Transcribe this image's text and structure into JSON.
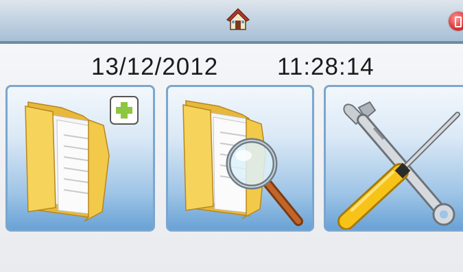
{
  "header": {
    "home_icon": "home-icon",
    "close_icon": "power-icon"
  },
  "status": {
    "date": "13/12/2012",
    "time": "11:28:14"
  },
  "tiles": [
    {
      "icon": "new-folder-icon"
    },
    {
      "icon": "search-folder-icon"
    },
    {
      "icon": "tools-icon"
    }
  ],
  "colors": {
    "topbar": "#bfd0e0",
    "tile_border": "#7aa6cf",
    "tile_gradient_bottom": "#6aa2d6",
    "folder_yellow": "#f3c94a",
    "plus_green": "#8dc63f"
  }
}
